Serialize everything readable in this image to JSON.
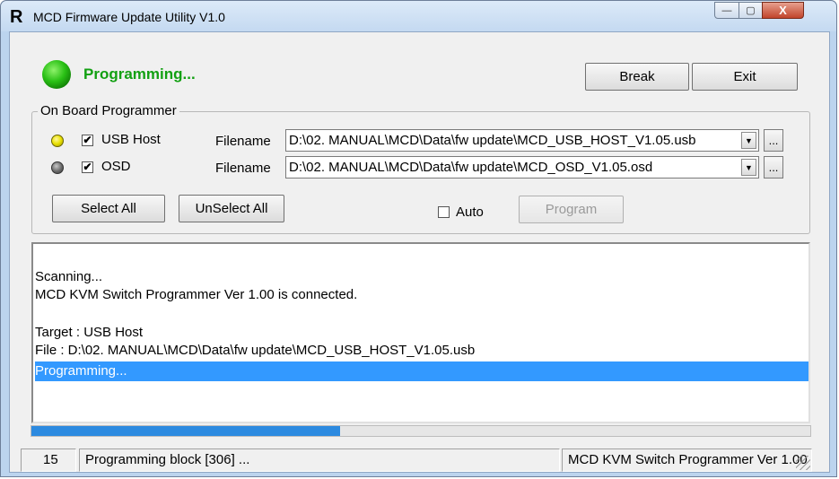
{
  "window": {
    "icon_letter": "R",
    "title": "MCD Firmware Update Utility V1.0",
    "controls": {
      "minimize": "—",
      "maximize": "▢",
      "close": "X"
    }
  },
  "status": {
    "heading": "Programming...",
    "led_color": "#29c015"
  },
  "toolbar": {
    "break_label": "Break",
    "exit_label": "Exit"
  },
  "programmer": {
    "group_label": "On Board Programmer",
    "rows": [
      {
        "led_color": "yellow",
        "checked": true,
        "check_mark": "✔",
        "label": "USB Host",
        "filename_label": "Filename",
        "filename": "D:\\02. MANUAL\\MCD\\Data\\fw update\\MCD_USB_HOST_V1.05.usb",
        "browse_label": "..."
      },
      {
        "led_color": "gray",
        "checked": true,
        "check_mark": "✔",
        "label": "OSD",
        "filename_label": "Filename",
        "filename": "D:\\02. MANUAL\\MCD\\Data\\fw update\\MCD_OSD_V1.05.osd",
        "browse_label": "..."
      }
    ],
    "select_all_label": "Select All",
    "unselect_all_label": "UnSelect All",
    "auto_label": "Auto",
    "auto_checked": false,
    "program_label": "Program",
    "program_enabled": false
  },
  "log": {
    "lines": [
      "Scanning...",
      "MCD KVM Switch Programmer Ver 1.00 is connected.",
      "",
      "Target : USB Host",
      "File : D:\\02. MANUAL\\MCD\\Data\\fw update\\MCD_USB_HOST_V1.05.usb",
      "Programming..."
    ],
    "selected_index": 5
  },
  "progress": {
    "fraction": 0.396,
    "color": "#2c8ae0"
  },
  "statusbar": {
    "count": "15",
    "message": "Programming block [306] ...",
    "device": "MCD KVM Switch Programmer Ver 1.00"
  }
}
